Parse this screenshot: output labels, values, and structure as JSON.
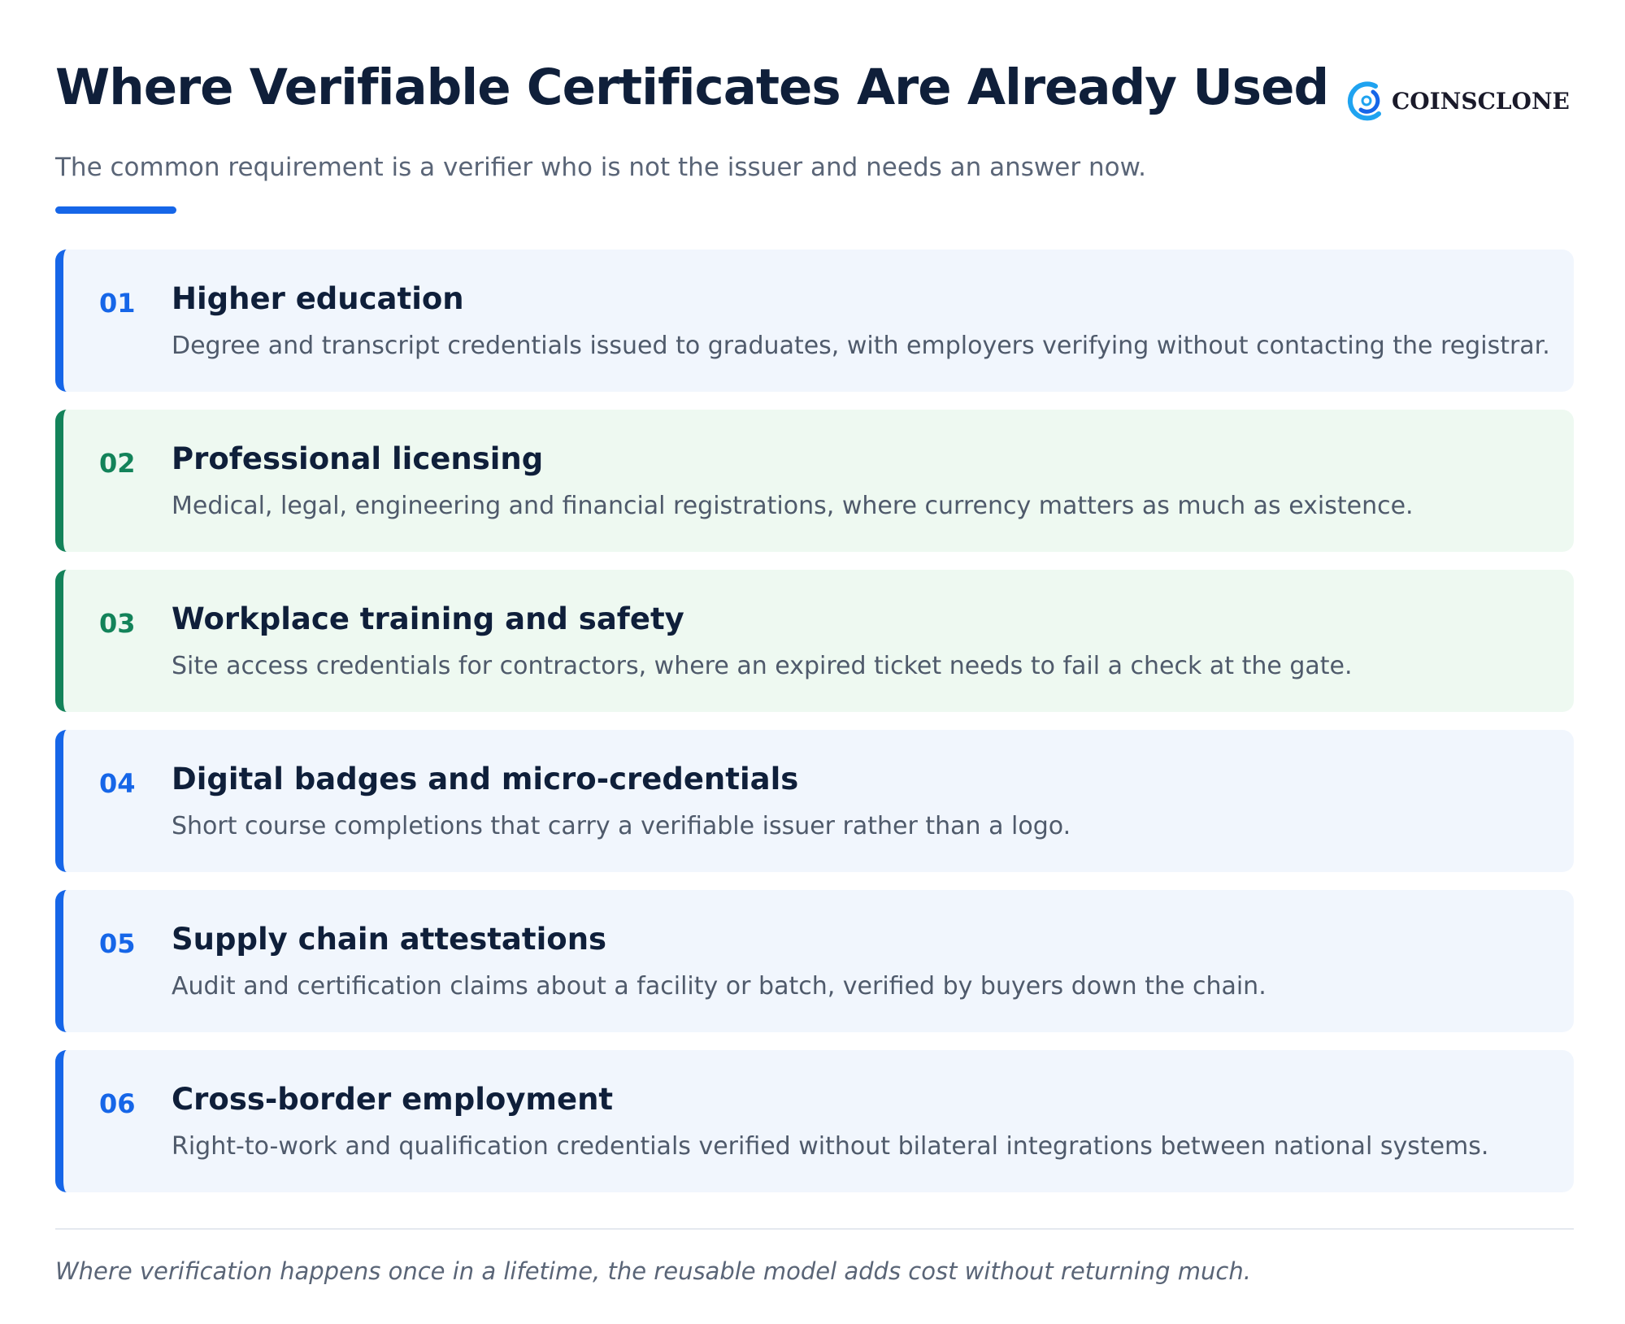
{
  "header": {
    "title": "Where Verifiable Certificates Are Already Used",
    "subtitle": "The common requirement is a verifier who is not the issuer and needs an answer now.",
    "logo_text": "COINSCLONE",
    "logo_icon": "coinsclone-logo-icon"
  },
  "colors": {
    "blue_accent": "#1666e8",
    "green_accent": "#13835a",
    "blue_card_bg": "#f1f6fd",
    "green_card_bg": "#eef9f1",
    "title_text": "#0f1f3a",
    "body_text": "#4f5a6b"
  },
  "cards": [
    {
      "number": "01",
      "title": "Higher education",
      "description": "Degree and transcript credentials issued to graduates, with employers verifying without contacting the registrar.",
      "accent": "blue"
    },
    {
      "number": "02",
      "title": "Professional licensing",
      "description": "Medical, legal, engineering and financial registrations, where currency matters as much as existence.",
      "accent": "green"
    },
    {
      "number": "03",
      "title": "Workplace training and safety",
      "description": "Site access credentials for contractors, where an expired ticket needs to fail a check at the gate.",
      "accent": "green"
    },
    {
      "number": "04",
      "title": "Digital badges and micro-credentials",
      "description": "Short course completions that carry a verifiable issuer rather than a logo.",
      "accent": "blue"
    },
    {
      "number": "05",
      "title": "Supply chain attestations",
      "description": "Audit and certification claims about a facility or batch, verified by buyers down the chain.",
      "accent": "blue"
    },
    {
      "number": "06",
      "title": "Cross-border employment",
      "description": "Right-to-work and qualification credentials verified without bilateral integrations between national systems.",
      "accent": "blue"
    }
  ],
  "footer": {
    "note": "Where verification happens once in a lifetime, the reusable model adds cost without returning much."
  }
}
